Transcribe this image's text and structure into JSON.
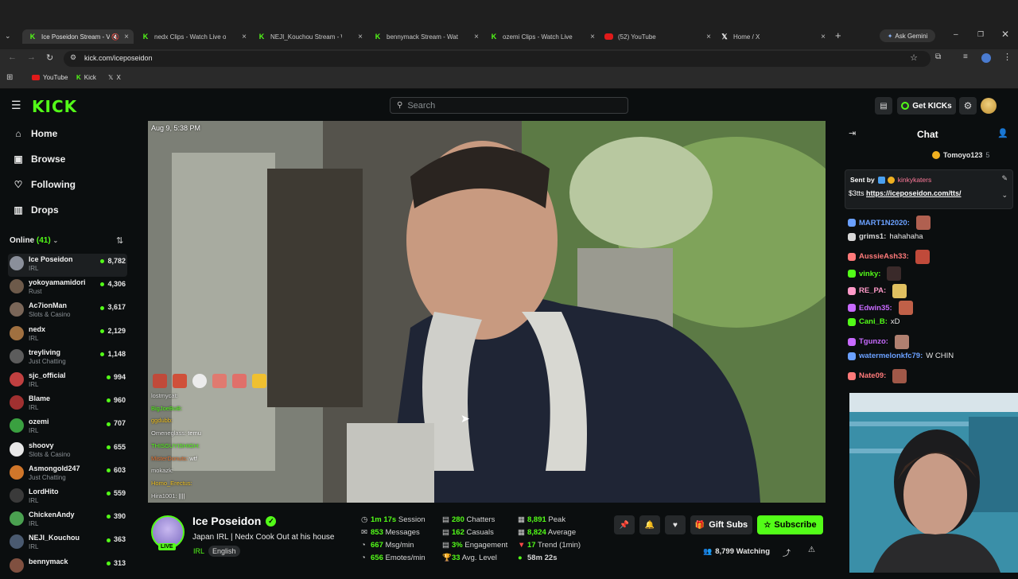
{
  "browser": {
    "tabs": [
      {
        "title": "Ice Poseidon Stream - V",
        "icon": "kick-favicon",
        "active": true,
        "muted": true
      },
      {
        "title": "nedx Clips - Watch Live on",
        "icon": "kick-favicon"
      },
      {
        "title": "NEJI_Kouchou Stream - Wa",
        "icon": "kick-favicon"
      },
      {
        "title": "bennymack Stream - Watch",
        "icon": "kick-favicon"
      },
      {
        "title": "ozemi Clips - Watch Live on",
        "icon": "kick-favicon"
      },
      {
        "title": "(52) YouTube",
        "icon": "youtube-favicon"
      },
      {
        "title": "Home / X",
        "icon": "x-favicon"
      }
    ],
    "ask_gemini": "Ask Gemini",
    "url": "kick.com/iceposeidon",
    "bookmarks": [
      "YouTube",
      "Kick",
      "X"
    ]
  },
  "header": {
    "logo": "KICK",
    "search_placeholder": "Search",
    "get_kicks": "Get KICKs"
  },
  "sidebar": {
    "nav": [
      {
        "label": "Home",
        "icon": "home-icon"
      },
      {
        "label": "Browse",
        "icon": "browse-icon"
      },
      {
        "label": "Following",
        "icon": "heart-icon"
      },
      {
        "label": "Drops",
        "icon": "drops-icon"
      }
    ],
    "online_label": "Online",
    "online_count": "(41)",
    "channels": [
      {
        "name": "Ice Poseidon",
        "category": "IRL",
        "viewers": "8,782",
        "color": "#8a8f9a"
      },
      {
        "name": "yokoyamamidori",
        "category": "Rust",
        "viewers": "4,306",
        "color": "#6d5a4a"
      },
      {
        "name": "Ac7ionMan",
        "category": "Slots & Casino",
        "viewers": "3,617",
        "color": "#7a6658"
      },
      {
        "name": "nedx",
        "category": "IRL",
        "viewers": "2,129",
        "color": "#a07040"
      },
      {
        "name": "treyliving",
        "category": "Just Chatting",
        "viewers": "1,148",
        "color": "#5c5c5c"
      },
      {
        "name": "sjc_official",
        "category": "IRL",
        "viewers": "994",
        "color": "#c04040"
      },
      {
        "name": "Blame",
        "category": "IRL",
        "viewers": "960",
        "color": "#a03030"
      },
      {
        "name": "ozemi",
        "category": "IRL",
        "viewers": "707",
        "color": "#3aa040"
      },
      {
        "name": "shoovy",
        "category": "Slots & Casino",
        "viewers": "655",
        "color": "#e8e8e8"
      },
      {
        "name": "Asmongold247",
        "category": "Just Chatting",
        "viewers": "603",
        "color": "#d0762a"
      },
      {
        "name": "LordHito",
        "category": "IRL",
        "viewers": "559",
        "color": "#3a3a3a"
      },
      {
        "name": "ChickenAndy",
        "category": "IRL",
        "viewers": "390",
        "color": "#4aa050"
      },
      {
        "name": "NEJI_Kouchou",
        "category": "IRL",
        "viewers": "363",
        "color": "#4a5a70"
      },
      {
        "name": "bennymack",
        "category": "",
        "viewers": "313",
        "color": "#805040"
      }
    ]
  },
  "video": {
    "timestamp": "Aug 9, 5:38 PM",
    "overlay_chat": [
      {
        "user": "lostmycat:",
        "msg": "",
        "color": "#e0e0e0"
      },
      {
        "user": "BigJoeBoB:",
        "msg": "",
        "color": "#53fc18"
      },
      {
        "user": "ggdubb:",
        "msg": "",
        "color": "#f0c020"
      },
      {
        "user": "Omeneglass:",
        "msg": "temu",
        "color": "#e0e0e0"
      },
      {
        "user": "THISGUYISHIGH:",
        "msg": "",
        "color": "#53fc18"
      },
      {
        "user": "MisterDonuts:",
        "msg": "wtf",
        "color": "#e07030"
      },
      {
        "user": "mokazk:",
        "msg": "",
        "color": "#e0e0e0"
      },
      {
        "user": "Homo_Erectus:",
        "msg": "",
        "color": "#f0c020"
      },
      {
        "user": "Hira1001:",
        "msg": "||||",
        "color": "#e0e0e0"
      }
    ]
  },
  "stream": {
    "name": "Ice Poseidon",
    "title": "Japan IRL | Nedx Cook Out at his house",
    "category": "IRL",
    "tag": "English",
    "live_badge": "LIVE",
    "stats": [
      {
        "value": "1m 17s",
        "label": "Session",
        "icon": "clock-icon"
      },
      {
        "value": "280",
        "label": "Chatters",
        "icon": "chatters-icon"
      },
      {
        "value": "8,891",
        "label": "Peak",
        "icon": "peak-icon"
      },
      {
        "value": "853",
        "label": "Messages",
        "icon": "message-icon"
      },
      {
        "value": "162",
        "label": "Casuals",
        "icon": "casuals-icon"
      },
      {
        "value": "8,824",
        "label": "Average",
        "icon": "average-icon"
      },
      {
        "value": "667",
        "label": "Msg/min",
        "icon": "speed-icon"
      },
      {
        "value": "3%",
        "label": "Engagement",
        "icon": "engagement-icon"
      },
      {
        "value": "17",
        "label": "Trend (1min)",
        "icon": "trend-down-icon"
      },
      {
        "value": "656",
        "label": "Emotes/min",
        "icon": "emote-speed-icon"
      },
      {
        "value": "33",
        "label": "Avg. Level",
        "icon": "trophy-icon"
      },
      {
        "value": "58m 22s",
        "label": "",
        "icon": "dot-icon"
      }
    ],
    "gift_subs": "Gift Subs",
    "subscribe": "Subscribe",
    "watching": "8,799 Watching"
  },
  "chat": {
    "title": "Chat",
    "top_user": "Tomoyo123",
    "top_amount": "5",
    "pinned": {
      "sent_by": "Sent by",
      "sender": "kinkykaters",
      "prefix": "$3tts",
      "link": "https://iceposeidon.com/tts/"
    },
    "messages": [
      {
        "user": "MART1N2020:",
        "text": "",
        "color": "#6aa0ff",
        "emote": true
      },
      {
        "user": "grims1:",
        "text": "hahahaha",
        "color": "#d8d8d8",
        "emote": false
      },
      {
        "user": "AussieAsh33:",
        "text": "",
        "color": "#ff7a7a",
        "emote": true
      },
      {
        "user": "vinky:",
        "text": "",
        "color": "#53fc18",
        "emote": true
      },
      {
        "user": "RE_PA:",
        "text": "",
        "color": "#ff9ac8",
        "emote": true
      },
      {
        "user": "Edwin35:",
        "text": "",
        "color": "#c86aff",
        "emote": true
      },
      {
        "user": "Cani_B:",
        "text": "xD",
        "color": "#53fc18",
        "emote": false
      },
      {
        "user": "Tgunzo:",
        "text": "",
        "color": "#c86aff",
        "emote": true
      },
      {
        "user": "watermelonkfc79:",
        "text": "W CHIN",
        "color": "#6aa0ff",
        "emote": false
      },
      {
        "user": "Nate09:",
        "text": "",
        "color": "#ff7a7a",
        "emote": true
      }
    ]
  }
}
